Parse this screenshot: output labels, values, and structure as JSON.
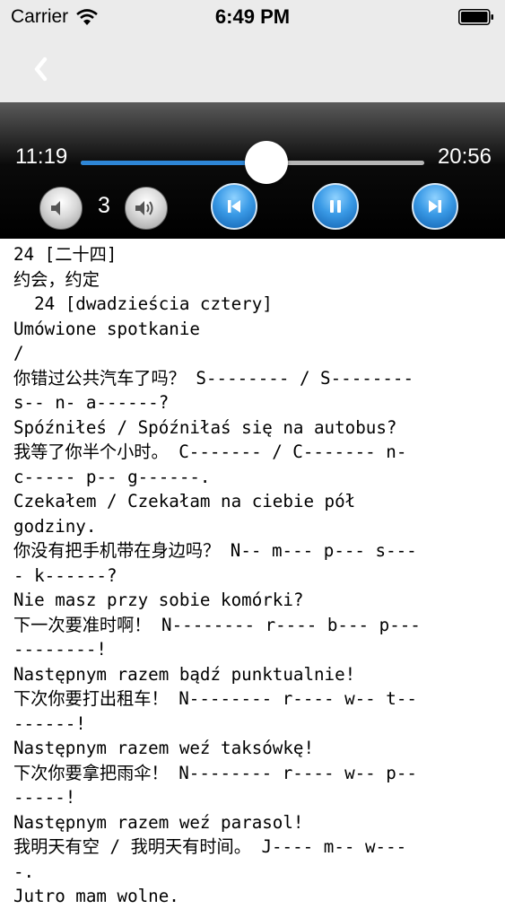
{
  "status_bar": {
    "carrier": "Carrier",
    "time": "6:49 PM"
  },
  "player": {
    "elapsed": "11:19",
    "total": "20:56",
    "progress_fraction": 0.54,
    "volume": "3",
    "accent_color": "#2e86d6"
  },
  "icons": {
    "back": "chevron-left-icon",
    "volume_down": "speaker-quiet-icon",
    "volume_up": "speaker-loud-icon",
    "previous": "skip-previous-icon",
    "pause": "pause-icon",
    "next": "skip-next-icon"
  },
  "lesson": {
    "lines": [
      "24 [二十四]",
      "约会，约定",
      "  24 [dwadzieścia cztery]",
      "Umówione spotkanie",
      "/",
      "你错过公共汽车了吗？ S-------- / S--------",
      "s-- n- a------?",
      "Spóźniłeś / Spóźniłaś się na autobus?",
      "我等了你半个小时。 C------- / C------- n-",
      "c----- p-- g------.",
      "Czekałem / Czekałam na ciebie pół",
      "godziny.",
      "你没有把手机带在身边吗？ N-- m--- p--- s---",
      "- k------?",
      "Nie masz przy sobie komórki?",
      "下一次要准时啊！ N-------- r---- b--- p---",
      "--------!",
      "Następnym razem bądź punktualnie!",
      "下次你要打出租车！ N-------- r---- w-- t--",
      "------!",
      "Następnym razem weź taksówkę!",
      "下次你要拿把雨伞！ N-------- r---- w-- p--",
      "-----!",
      "Następnym razem weź parasol!",
      "我明天有空 / 我明天有时间。 J---- m-- w---",
      "-.",
      "Jutro mam wolne."
    ]
  }
}
